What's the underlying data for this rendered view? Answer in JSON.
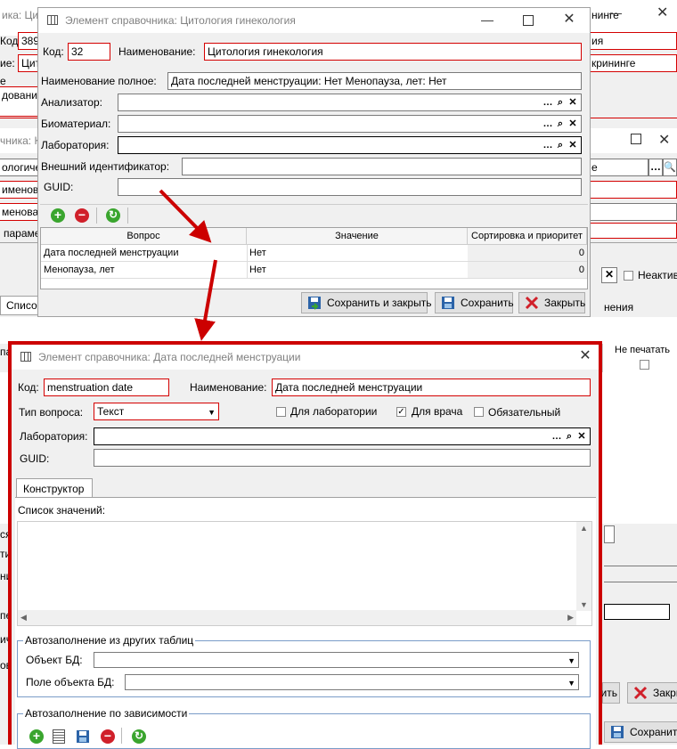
{
  "background": {
    "title_left": "ика: Цито",
    "code_label_frag": "Код:",
    "code_value_frag": "389",
    "name_label_frag": "ие:",
    "name_value_frag": "Цит",
    "right_value_1": "ия",
    "right_value_2": "крининге",
    "title_right": "нинге",
    "section_frag": "е",
    "research_frag": "дование",
    "win2_title": "чника: Ка",
    "row1": "ологиче",
    "row2": "именован",
    "row3": "менова",
    "row4": "параме",
    "right_frag_e": "е",
    "inactive_label": "Неактив",
    "tab_list": "Список",
    "right_frag_ln": "нения",
    "right_frag_pa": "па",
    "no_print_label": "Не печатать",
    "left_frags": [
      "ся",
      "ти",
      "ни",
      "пе",
      "ич",
      "ов"
    ],
    "right_btn_frag": "нить",
    "right_close_frag": "Закры",
    "bottom_save": "Сохранить"
  },
  "dialog1": {
    "title": "Элемент справочника: Цитология гинекология",
    "code_label": "Код:",
    "code_value": "32",
    "name_label": "Наименование:",
    "name_value": "Цитология гинекология",
    "fullname_label": "Наименование полное:",
    "fullname_value": "Дата последней менструации: Нет Менопауза, лет: Нет",
    "analyzer_label": "Анализатор:",
    "biomaterial_label": "Биоматериал:",
    "lab_label": "Лаборатория:",
    "extid_label": "Внешний идентификатор:",
    "guid_label": "GUID:",
    "table": {
      "columns": [
        "Вопрос",
        "Значение",
        "Сортировка и приоритет"
      ],
      "rows": [
        {
          "question": "Дата последней менструации",
          "value": "Нет",
          "sort": "0"
        },
        {
          "question": "Менопауза, лет",
          "value": "Нет",
          "sort": "0"
        }
      ]
    },
    "buttons": {
      "save_close": "Сохранить и закрыть",
      "save": "Сохранить",
      "close": "Закрыть"
    }
  },
  "dialog2": {
    "title": "Элемент справочника: Дата последней менструации",
    "code_label": "Код:",
    "code_value": "menstruation date",
    "name_label": "Наименование:",
    "name_value": "Дата последней менструации",
    "qtype_label": "Тип вопроса:",
    "qtype_value": "Текст",
    "for_lab_label": "Для лаборатории",
    "for_lab_checked": false,
    "for_doctor_label": "Для врача",
    "for_doctor_checked": true,
    "required_label": "Обязательный",
    "required_checked": false,
    "lab_label": "Лаборатория:",
    "guid_label": "GUID:",
    "tab_label": "Конструктор",
    "values_list_label": "Список значений:",
    "autofill_group": "Автозаполнение из других таблиц",
    "db_object_label": "Объект БД:",
    "db_field_label": "Поле объекта БД:",
    "autofill_dep_group": "Автозаполнение по зависимости"
  },
  "colors": {
    "highlight": "#cc0000",
    "field_error_border": "#d40000",
    "add": "#3aa52e",
    "remove": "#d0202a",
    "refresh": "#3aa52e"
  }
}
